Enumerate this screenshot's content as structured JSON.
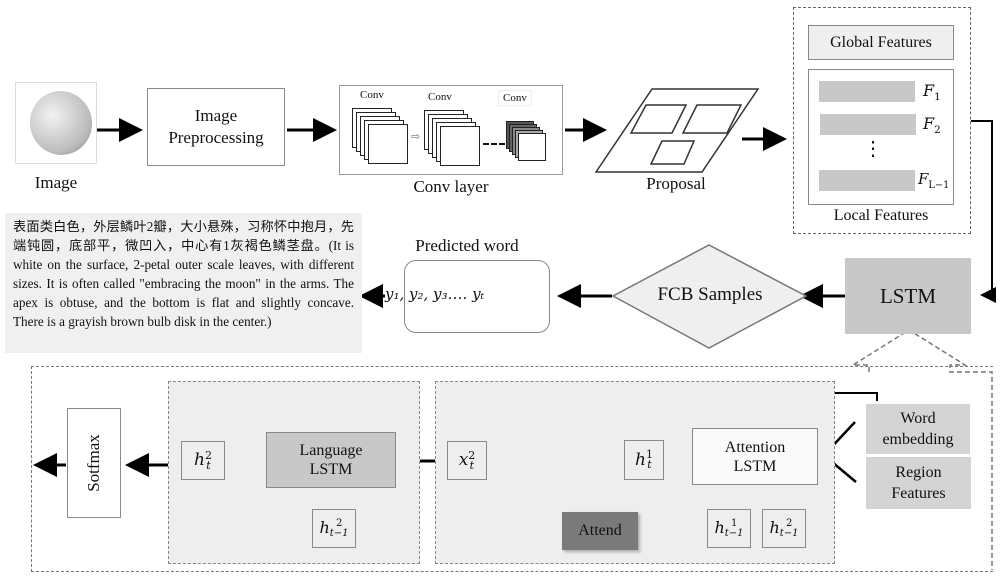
{
  "pipeline": {
    "image_label": "Image",
    "preprocessing_label_line1": "Image",
    "preprocessing_label_line2": "Preprocessing",
    "conv_labels": [
      "Conv",
      "Conv",
      "Conv"
    ],
    "conv_layer_label": "Conv layer",
    "proposal_label": "Proposal"
  },
  "features": {
    "global_label": "Global Features",
    "local_label": "Local Features",
    "items": [
      "F",
      "F",
      "F"
    ],
    "item_subscripts": [
      "1",
      "2",
      "L−1"
    ],
    "ellipsis": "⋮"
  },
  "middle": {
    "lstm_label": "LSTM",
    "fcb_label": "FCB Samples",
    "predicted_title": "Predicted word",
    "predicted_sequence": "y₁, y₂, y₃…. yₜ"
  },
  "description": {
    "text": "表面类白色，外层鳞叶2瓣，大小悬殊，习称怀中抱月，先端钝圆，底部平，微凹入，中心有1灰褐色鳞茎盘。(It is white on the surface, 2-petal outer scale leaves, with different sizes. It is often called \"embracing the moon\" in the arms. The apex is obtuse, and the bottom is flat and slightly concave. There is a grayish brown bulb disk in the center.)"
  },
  "decoder": {
    "softmax_label": "Sotfmax",
    "h_t2": {
      "base": "h",
      "sup": "2",
      "sub": "t"
    },
    "language_lstm_line1": "Language",
    "language_lstm_line2": "LSTM",
    "h_tm1_2_lang": {
      "base": "h",
      "sup": "2",
      "sub": "t−1"
    },
    "x_t2": {
      "base": "x",
      "sup": "2",
      "sub": "t"
    },
    "h_t1": {
      "base": "h",
      "sup": "1",
      "sub": "t"
    },
    "attend_label": "Attend",
    "attention_lstm_line1": "Attention",
    "attention_lstm_line2": "LSTM",
    "h_tm1_1": {
      "base": "h",
      "sup": "1",
      "sub": "t−1"
    },
    "h_tm1_2": {
      "base": "h",
      "sup": "2",
      "sub": "t−1"
    },
    "word_embedding_line1": "Word",
    "word_embedding_line2": "embedding",
    "region_features_line1": "Region",
    "region_features_line2": "Features"
  },
  "colors": {
    "gray_block": "#c8c8c8",
    "light_panel": "#eeeeee",
    "attend_block": "#7a7a7a",
    "border": "#8a8a8a"
  }
}
